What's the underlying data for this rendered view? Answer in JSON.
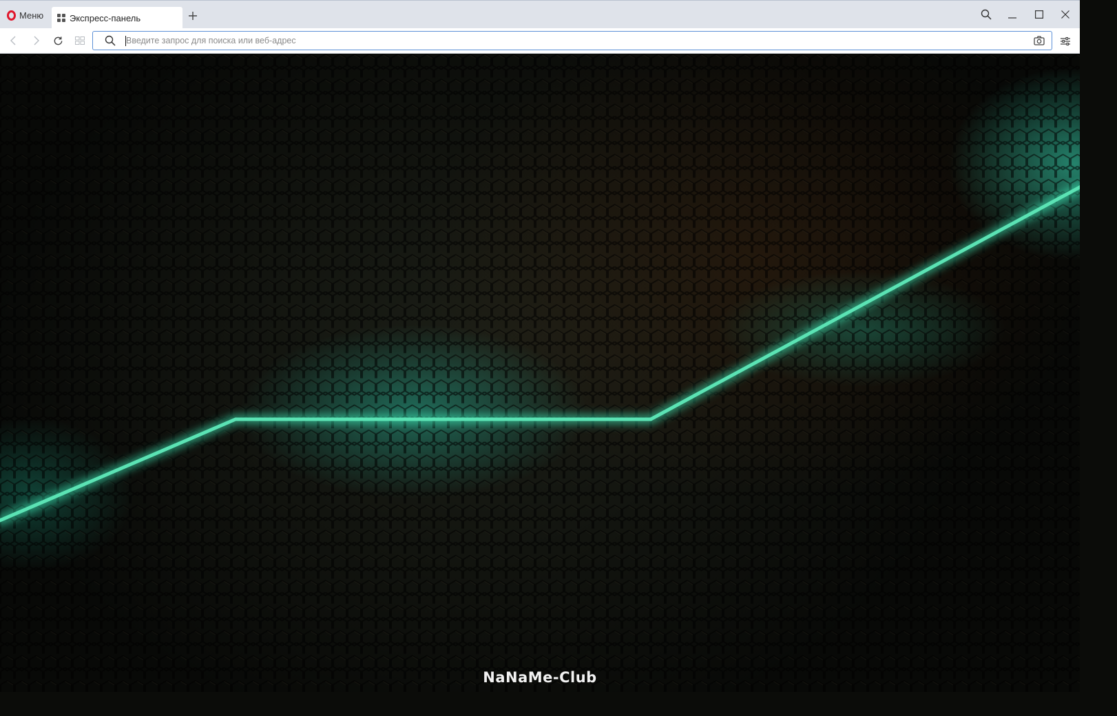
{
  "browser": {
    "menu_label": "Меню",
    "tabs": [
      {
        "title": "Экспресс-панель",
        "icon": "speed-dial-icon",
        "active": true
      }
    ],
    "new_tab_icon": "plus-icon",
    "window_controls": [
      "search-icon",
      "minimize-icon",
      "maximize-icon",
      "close-icon"
    ]
  },
  "toolbar": {
    "back_icon": "back-arrow-icon",
    "forward_icon": "forward-arrow-icon",
    "reload_icon": "reload-icon",
    "speed_dial_icon": "speed-dial-icon",
    "address_placeholder": "Введите запрос для поиска или веб-адрес",
    "address_value": "",
    "camera_icon": "camera-icon",
    "easy_setup_icon": "easy-setup-icon"
  },
  "speed_dial": {
    "background": "dark honeycomb with glowing teal line",
    "watermark": "NaNaMe-Club",
    "accent_color": "#5be3b4"
  },
  "colors": {
    "opera_red": "#e0162b",
    "tabstrip": "#dfe3ea",
    "address_border": "#5a8fd6"
  }
}
